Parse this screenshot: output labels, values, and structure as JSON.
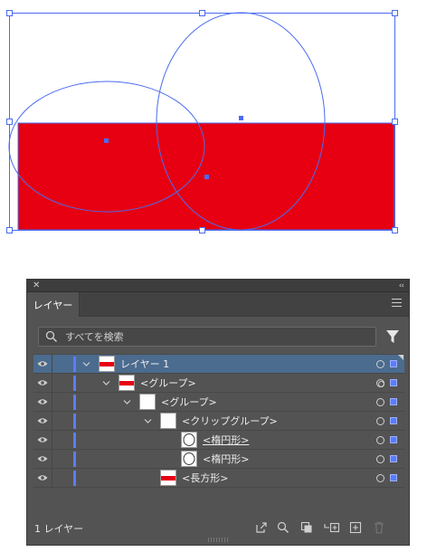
{
  "panel": {
    "tab_label": "レイヤー",
    "search_placeholder": "すべてを検索",
    "footer_count": "1 レイヤー"
  },
  "layers": [
    {
      "label": "レイヤー 1",
      "thumb": "red-band",
      "expanded": true,
      "selected": true,
      "target": "single"
    },
    {
      "label": "<グループ>",
      "thumb": "red-band",
      "expanded": true,
      "selected": false,
      "target": "double"
    },
    {
      "label": "<グループ>",
      "thumb": "blank",
      "expanded": true,
      "selected": false,
      "target": "single"
    },
    {
      "label": "<クリップグループ>",
      "thumb": "blank",
      "expanded": true,
      "selected": false,
      "target": "single"
    },
    {
      "label": "<楕円形>",
      "thumb": "ellipse",
      "expanded": false,
      "selected": false,
      "target": "single",
      "underlined": true
    },
    {
      "label": "<楕円形>",
      "thumb": "ellipse",
      "expanded": false,
      "selected": false,
      "target": "single"
    },
    {
      "label": "<長方形>",
      "thumb": "red-band",
      "expanded": false,
      "selected": false,
      "target": "single"
    }
  ],
  "colors": {
    "artwork_fill": "#e60012",
    "selection_blue": "#4a6cf0",
    "panel_bg": "#535353",
    "selected_row": "#4b6b8f"
  },
  "icons": [
    "close-icon",
    "collapse-icon",
    "panel-menu-icon",
    "search-icon",
    "filter-icon",
    "eye-icon",
    "chevron-down-icon",
    "export-icon",
    "locate-object-icon",
    "clipping-mask-icon",
    "new-sublayer-icon",
    "new-layer-icon",
    "trash-icon"
  ]
}
